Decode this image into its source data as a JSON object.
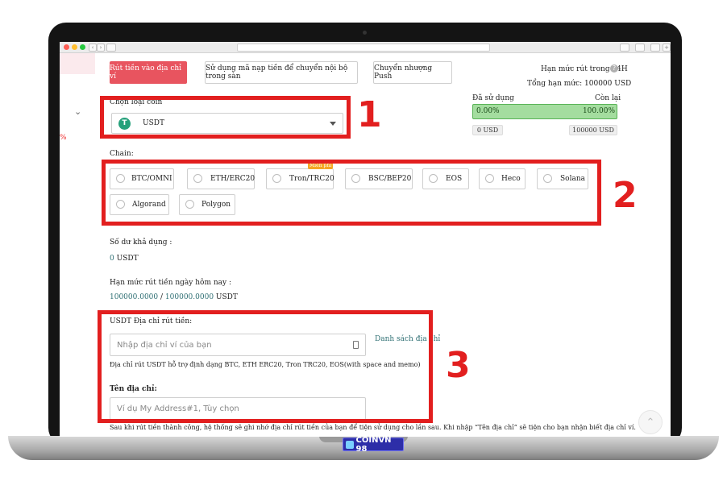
{
  "tabs": {
    "withdraw_address": "Rút tiền vào địa chỉ ví",
    "internal_transfer": "Sử dụng mã nạp tiền để chuyển nội bộ trong sàn",
    "push_transfer": "Chuyển nhượng Push"
  },
  "limit": {
    "title": "Hạn mức rút trong 24H",
    "help_icon": "?",
    "total": "Tổng hạn mức: 100000 USD",
    "used_label": "Đã sử dụng",
    "remaining_label": "Còn lại",
    "used_percent_text": "0.00%",
    "remaining_percent_text": "100.00%",
    "used_fraction": 0.0,
    "used_value": "0 USD",
    "remaining_value": "100000 USD"
  },
  "coin": {
    "label": "Chọn loại coin",
    "icon_glyph": "T",
    "selected": "USDT"
  },
  "chain": {
    "label": "Chain:",
    "free_badge": "Miễn phí",
    "options": [
      "BTC/OMNI",
      "ETH/ERC20",
      "Tron/TRC20",
      "BSC/BEP20",
      "EOS",
      "Heco",
      "Solana",
      "Algorand",
      "Polygon"
    ]
  },
  "balance": {
    "label": "Số dư khả dụng :",
    "amount": "0",
    "unit": "USDT"
  },
  "daily": {
    "label": "Hạn mức rút tiền ngày hôm nay :",
    "used": "100000.0000",
    "separator": "/",
    "total": "100000.0000",
    "unit": "USDT"
  },
  "address": {
    "label": "USDT Địa chỉ rút tiền:",
    "placeholder": "Nhập địa chỉ ví của bạn",
    "list_link": "Danh sách địa chỉ",
    "hint": "Địa chỉ rút USDT hỗ trợ định dạng BTC, ETH ERC20, Tron TRC20, EOS(with space and memo)",
    "name_label": "Tên địa chỉ:",
    "name_placeholder": "Ví dụ My Address#1, Tùy chọn",
    "bottom_note": "Sau khi rút tiền thành công, hệ thống sẽ ghi nhớ địa chỉ rút tiền của bạn để tiện sử dụng cho lần sau. Khi nhập “Tên địa chỉ” sẽ tiện cho bạn nhận biết địa chỉ ví."
  },
  "annotations": [
    "1",
    "2",
    "3"
  ],
  "watermark": "COINVN 98",
  "sidebar": {
    "chevron": "⌄",
    "mark": "%"
  },
  "scroll_top_icon": "⌃",
  "colors": {
    "accent": "#e8545f",
    "annotation": "#e21f1f",
    "progress": "#a4dd9f",
    "teal": "#2e6f73",
    "tether": "#26a17b"
  }
}
